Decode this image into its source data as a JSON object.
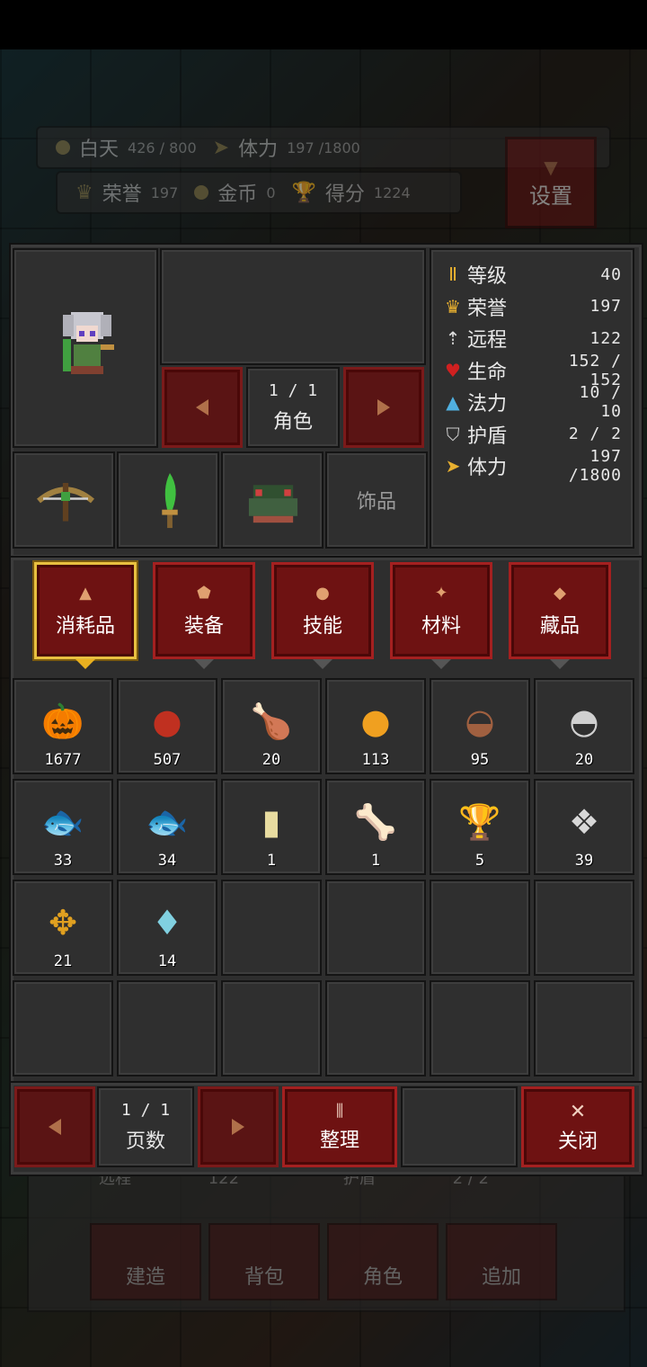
{
  "hud": {
    "day_label": "白天",
    "day_value": "426 / 800",
    "stamina_label": "体力",
    "stamina_value": "197 /1800",
    "honor_label": "荣誉",
    "honor_value": "197",
    "gold_label": "金币",
    "gold_value": "0",
    "score_label": "得分",
    "score_value": "1224",
    "settings_label": "设置"
  },
  "character": {
    "page": "1 / 1",
    "page_label": "角色",
    "accessory_label": "饰品"
  },
  "stats": [
    {
      "icon": "level-icon",
      "glyph": "Ⅱ",
      "color": "#e8b030",
      "label": "等级",
      "value": "40"
    },
    {
      "icon": "crown-icon",
      "glyph": "♛",
      "color": "#e8b030",
      "label": "荣誉",
      "value": "197"
    },
    {
      "icon": "ranged-icon",
      "glyph": "⇡",
      "color": "#dddddd",
      "label": "远程",
      "value": "122"
    },
    {
      "icon": "heart-icon",
      "glyph": "♥",
      "color": "#d02020",
      "label": "生命",
      "value": "152 / 152"
    },
    {
      "icon": "mana-icon",
      "glyph": "▲",
      "color": "#50b0e0",
      "label": "法力",
      "value": "10 / 10"
    },
    {
      "icon": "shield-icon",
      "glyph": "⛉",
      "color": "#cccccc",
      "label": "护盾",
      "value": "2 / 2"
    },
    {
      "icon": "stamina-icon",
      "glyph": "➤",
      "color": "#e8b030",
      "label": "体力",
      "value": "197 /1800"
    }
  ],
  "tabs": [
    {
      "label": "消耗品",
      "glyph": "▲",
      "active": true
    },
    {
      "label": "装备",
      "glyph": "⬟",
      "active": false
    },
    {
      "label": "技能",
      "glyph": "●",
      "active": false
    },
    {
      "label": "材料",
      "glyph": "✦",
      "active": false
    },
    {
      "label": "藏品",
      "glyph": "◆",
      "active": false
    }
  ],
  "items": [
    {
      "name": "pumpkin-icon",
      "glyph": "🎃",
      "color": "#e07020",
      "count": "1677"
    },
    {
      "name": "berries-icon",
      "glyph": "●",
      "color": "#c03020",
      "count": "507"
    },
    {
      "name": "drumstick-icon",
      "glyph": "🍗",
      "color": "#a07060",
      "count": "20"
    },
    {
      "name": "fried-egg-icon",
      "glyph": "●",
      "color": "#f0a020",
      "count": "113"
    },
    {
      "name": "soup-bowl-icon",
      "glyph": "◒",
      "color": "#a06040",
      "count": "95"
    },
    {
      "name": "rice-bowl-icon",
      "glyph": "◓",
      "color": "#d0d0d0",
      "count": "20"
    },
    {
      "name": "fish-icon",
      "glyph": "🐟",
      "color": "#d8c8a0",
      "count": "33"
    },
    {
      "name": "blue-fish-icon",
      "glyph": "🐟",
      "color": "#80b0c8",
      "count": "34"
    },
    {
      "name": "jar-icon",
      "glyph": "▮",
      "color": "#e8dca0",
      "count": "1"
    },
    {
      "name": "bone-icon",
      "glyph": "🦴",
      "color": "#d8d8d8",
      "count": "1"
    },
    {
      "name": "goblet-icon",
      "glyph": "🏆",
      "color": "#e0a020",
      "count": "5"
    },
    {
      "name": "winged-statue-icon",
      "glyph": "❖",
      "color": "#d8d8d8",
      "count": "39"
    },
    {
      "name": "gold-gear-icon",
      "glyph": "✥",
      "color": "#e0a020",
      "count": "21"
    },
    {
      "name": "crystal-icon",
      "glyph": "♦",
      "color": "#80d0e0",
      "count": "14"
    }
  ],
  "bottom": {
    "page": "1 / 1",
    "page_label": "页数",
    "sort_label": "整理",
    "close_label": "关闭"
  },
  "background_menu": [
    "建造",
    "背包",
    "角色",
    "追加"
  ],
  "background_row": [
    "远程",
    "122",
    "护盾",
    "2 / 2"
  ]
}
